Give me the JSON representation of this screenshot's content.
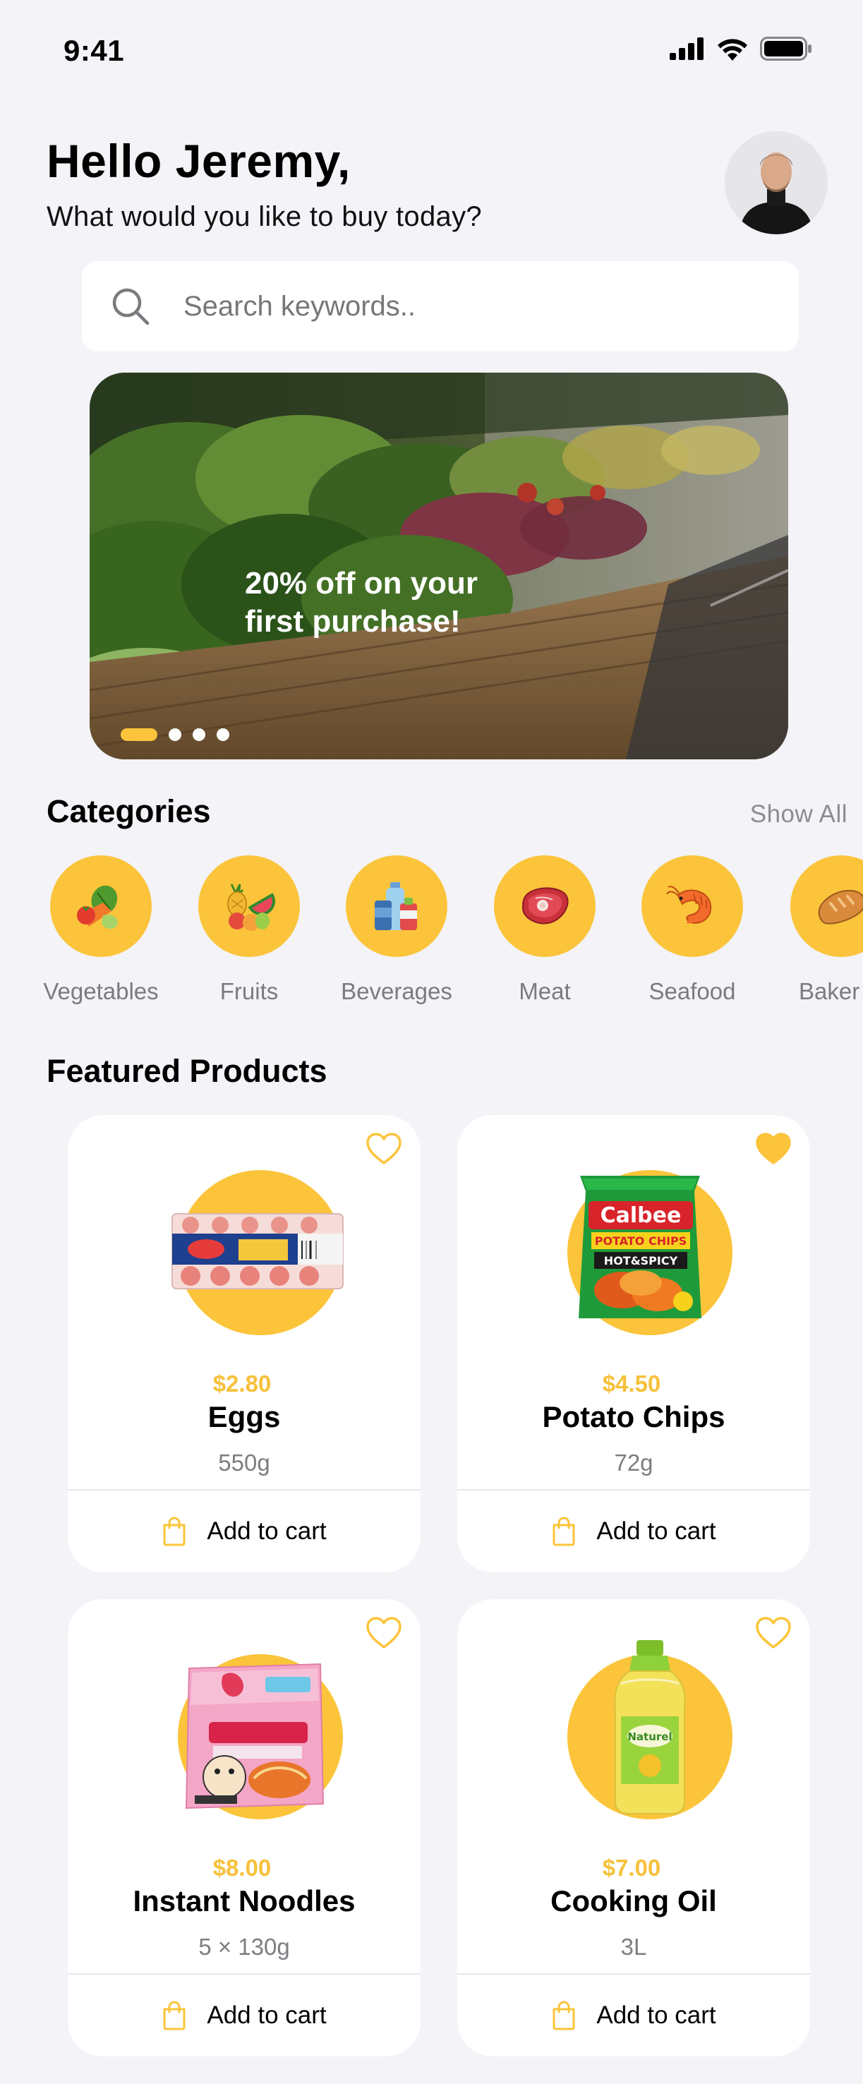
{
  "status_bar": {
    "time": "9:41"
  },
  "header": {
    "greeting": "Hello Jeremy,",
    "subtitle": "What would you like to buy today?"
  },
  "search": {
    "placeholder": "Search keywords.."
  },
  "banner": {
    "text": "20% off on your\nfirst purchase!",
    "dots_total": 4,
    "active_dot": 1
  },
  "categories_section": {
    "title": "Categories",
    "show_all": "Show All",
    "items": [
      {
        "label": "Vegetables",
        "icon": "vegetables-icon"
      },
      {
        "label": "Fruits",
        "icon": "fruits-icon"
      },
      {
        "label": "Beverages",
        "icon": "beverages-icon"
      },
      {
        "label": "Meat",
        "icon": "meat-icon"
      },
      {
        "label": "Seafood",
        "icon": "seafood-icon"
      },
      {
        "label": "Baker",
        "icon": "bakery-icon"
      }
    ]
  },
  "featured": {
    "title": "Featured Products",
    "add_to_cart": "Add to cart",
    "products": [
      {
        "price": "$2.80",
        "name": "Eggs",
        "size": "550g",
        "favorite": false
      },
      {
        "price": "$4.50",
        "name": "Potato Chips",
        "size": "72g",
        "favorite": true
      },
      {
        "price": "$8.00",
        "name": "Instant Noodles",
        "size": "5 × 130g",
        "favorite": false
      },
      {
        "price": "$7.00",
        "name": "Cooking Oil",
        "size": "3L",
        "favorite": false
      }
    ]
  },
  "colors": {
    "accent": "#fbc43a",
    "background": "#f3f3f8",
    "price": "#f6c13b"
  }
}
